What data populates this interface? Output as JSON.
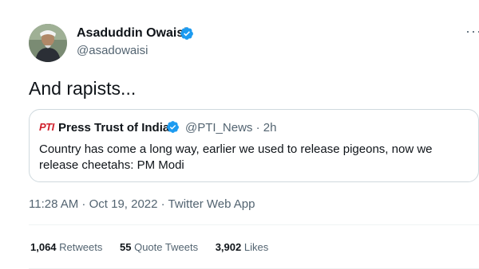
{
  "author": {
    "name": "Asaduddin Owaisi",
    "handle": "@asadowaisi"
  },
  "tweet": {
    "text": "And rapists..."
  },
  "quote": {
    "logo_text": "PTI",
    "author_name": "Press Trust of India",
    "meta": "@PTI_News · 2h",
    "body": "Country has come a long way, earlier we used to release pigeons, now we release cheetahs: PM Modi"
  },
  "timestamp": "11:28 AM · Oct 19, 2022 · Twitter Web App",
  "stats": {
    "retweets_count": "1,064",
    "retweets_label": "Retweets",
    "quotes_count": "55",
    "quotes_label": "Quote Tweets",
    "likes_count": "3,902",
    "likes_label": "Likes"
  },
  "icons": {
    "verified": "verified-badge-icon",
    "more": "more-icon",
    "avatar": "avatar"
  },
  "colors": {
    "verified_blue": "#1d9bf0",
    "secondary_text": "#536471",
    "pti_red": "#d0202c",
    "border": "#cfd9de"
  }
}
